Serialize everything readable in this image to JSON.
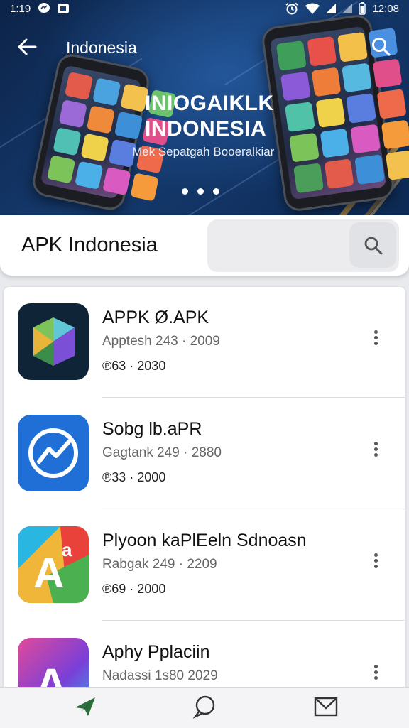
{
  "status_bar": {
    "time_left": "1:19",
    "time_right": "12:08"
  },
  "header": {
    "title": "Indonesia"
  },
  "hero": {
    "brand_line1": "INIOGAIKLK",
    "brand_line2": "INDONESIA",
    "subtitle": "Mek Sepatgah Booeralkiar",
    "slide_count": 3,
    "active_slide": 2
  },
  "search": {
    "title": "APK Indonesia",
    "placeholder": ""
  },
  "apps": [
    {
      "name": "APPK Ø.APK",
      "meta": "Apptesh 243 · 2009",
      "stats": "℗63 · 2030",
      "icon": "play-prism-icon"
    },
    {
      "name": "Sobg lb.aPR",
      "meta": "Gagtank 249 · 2880",
      "stats": "℗33 · 2000",
      "icon": "trend-circle-icon"
    },
    {
      "name": "Plyoon kaPlEeln Sdnoasn",
      "meta": "Rabgak 249 · 2209",
      "stats": "℗69 · 2000",
      "icon": "letter-a-colorful-icon"
    },
    {
      "name": "Aphy Pplaciin",
      "meta": "Nadassi 1s80 2029",
      "stats": "",
      "icon": "letter-a-purple-icon"
    }
  ],
  "bottom_nav": [
    {
      "label": "",
      "icon": "send-leaf-icon"
    },
    {
      "label": "",
      "icon": "chat-bubble-icon"
    },
    {
      "label": "",
      "icon": "mail-icon"
    }
  ],
  "colors": {
    "hero_dark": "#0c2348",
    "accent_gold": "#c9a35a",
    "list_bg": "#ffffff",
    "page_bg": "#e9eaed"
  }
}
